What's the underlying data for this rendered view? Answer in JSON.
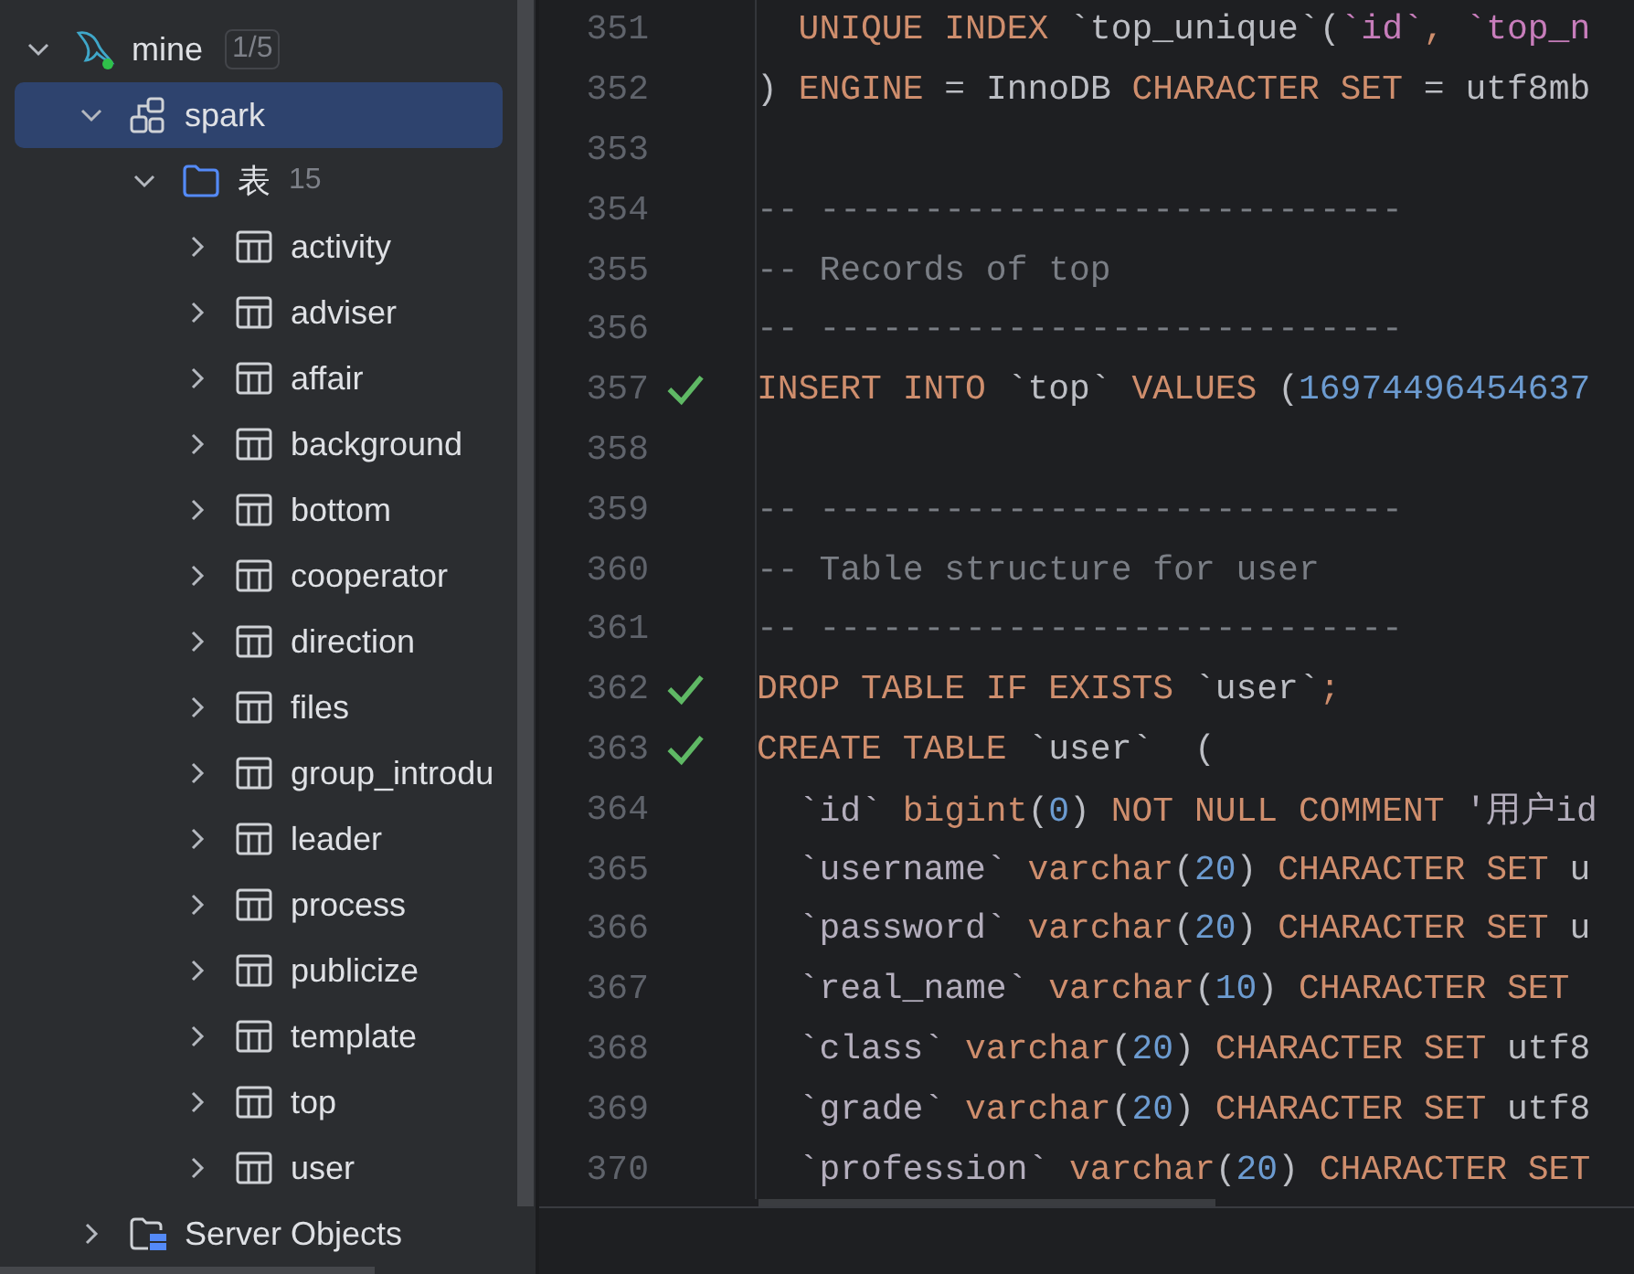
{
  "tree": [
    {
      "kind": "connection",
      "label": "mine",
      "badge": "1/5",
      "expanded": true,
      "selected": false,
      "children": [
        {
          "kind": "schema",
          "label": "spark",
          "expanded": true,
          "selected": true,
          "children": [
            {
              "kind": "folder",
              "label": "表",
              "count": "15",
              "expanded": true,
              "selected": false,
              "children": [
                {
                  "kind": "table",
                  "label": "activity",
                  "expanded": false,
                  "selected": false
                },
                {
                  "kind": "table",
                  "label": "adviser",
                  "expanded": false,
                  "selected": false
                },
                {
                  "kind": "table",
                  "label": "affair",
                  "expanded": false,
                  "selected": false
                },
                {
                  "kind": "table",
                  "label": "background",
                  "expanded": false,
                  "selected": false
                },
                {
                  "kind": "table",
                  "label": "bottom",
                  "expanded": false,
                  "selected": false
                },
                {
                  "kind": "table",
                  "label": "cooperator",
                  "expanded": false,
                  "selected": false
                },
                {
                  "kind": "table",
                  "label": "direction",
                  "expanded": false,
                  "selected": false
                },
                {
                  "kind": "table",
                  "label": "files",
                  "expanded": false,
                  "selected": false
                },
                {
                  "kind": "table",
                  "label": "group_introdu",
                  "expanded": false,
                  "selected": false
                },
                {
                  "kind": "table",
                  "label": "leader",
                  "expanded": false,
                  "selected": false
                },
                {
                  "kind": "table",
                  "label": "process",
                  "expanded": false,
                  "selected": false
                },
                {
                  "kind": "table",
                  "label": "publicize",
                  "expanded": false,
                  "selected": false
                },
                {
                  "kind": "table",
                  "label": "template",
                  "expanded": false,
                  "selected": false
                },
                {
                  "kind": "table",
                  "label": "top",
                  "expanded": false,
                  "selected": false
                },
                {
                  "kind": "table",
                  "label": "user",
                  "expanded": false,
                  "selected": false
                }
              ]
            }
          ]
        },
        {
          "kind": "server",
          "label": "Server Objects",
          "expanded": false,
          "selected": false
        }
      ]
    }
  ],
  "editor": {
    "lines": [
      {
        "number": "351",
        "checked": false,
        "indented": true,
        "tokens": [
          {
            "kind": "keyword",
            "text": "UNIQUE INDEX "
          },
          {
            "kind": "plain",
            "text": "`top_unique`("
          },
          {
            "kind": "field",
            "text": "`id`"
          },
          {
            "kind": "keyword",
            "text": ", "
          },
          {
            "kind": "field",
            "text": "`top_n"
          }
        ]
      },
      {
        "number": "352",
        "checked": false,
        "indented": false,
        "tokens": [
          {
            "kind": "plain",
            "text": ") "
          },
          {
            "kind": "keyword",
            "text": "ENGINE"
          },
          {
            "kind": "plain",
            "text": " = InnoDB "
          },
          {
            "kind": "keyword",
            "text": "CHARACTER SET"
          },
          {
            "kind": "plain",
            "text": " = utf8mb"
          }
        ]
      },
      {
        "number": "353",
        "checked": false
      },
      {
        "number": "354",
        "checked": false,
        "indented": false,
        "tokens": [
          {
            "kind": "comment",
            "text": "-- ----------------------------"
          }
        ]
      },
      {
        "number": "355",
        "checked": false,
        "indented": false,
        "tokens": [
          {
            "kind": "comment",
            "text": "-- Records of top"
          }
        ]
      },
      {
        "number": "356",
        "checked": false,
        "indented": false,
        "tokens": [
          {
            "kind": "comment",
            "text": "-- ----------------------------"
          }
        ]
      },
      {
        "number": "357",
        "checked": true,
        "indented": false,
        "tokens": [
          {
            "kind": "keyword",
            "text": "INSERT INTO"
          },
          {
            "kind": "plain",
            "text": " `top` "
          },
          {
            "kind": "keyword",
            "text": "VALUES"
          },
          {
            "kind": "plain",
            "text": " ("
          },
          {
            "kind": "number",
            "text": "16974496454637"
          }
        ]
      },
      {
        "number": "358",
        "checked": false
      },
      {
        "number": "359",
        "checked": false,
        "indented": false,
        "tokens": [
          {
            "kind": "comment",
            "text": "-- ----------------------------"
          }
        ]
      },
      {
        "number": "360",
        "checked": false,
        "indented": false,
        "tokens": [
          {
            "kind": "comment",
            "text": "-- Table structure for user"
          }
        ]
      },
      {
        "number": "361",
        "checked": false,
        "indented": false,
        "tokens": [
          {
            "kind": "comment",
            "text": "-- ----------------------------"
          }
        ]
      },
      {
        "number": "362",
        "checked": true,
        "indented": false,
        "tokens": [
          {
            "kind": "keyword",
            "text": "DROP TABLE IF EXISTS"
          },
          {
            "kind": "plain",
            "text": " `user`"
          },
          {
            "kind": "keyword",
            "text": ";"
          }
        ]
      },
      {
        "number": "363",
        "checked": true,
        "indented": false,
        "tokens": [
          {
            "kind": "keyword",
            "text": "CREATE TABLE"
          },
          {
            "kind": "plain",
            "text": " `user`  ("
          }
        ]
      },
      {
        "number": "364",
        "checked": false,
        "indented": true,
        "tokens": [
          {
            "kind": "name",
            "text": "`id` "
          },
          {
            "kind": "keyword",
            "text": "bigint"
          },
          {
            "kind": "plain",
            "text": "("
          },
          {
            "kind": "number",
            "text": "0"
          },
          {
            "kind": "plain",
            "text": ") "
          },
          {
            "kind": "keyword",
            "text": "NOT NULL COMMENT"
          },
          {
            "kind": "name",
            "text": " '用户id"
          }
        ]
      },
      {
        "number": "365",
        "checked": false,
        "indented": true,
        "tokens": [
          {
            "kind": "name",
            "text": "`username` "
          },
          {
            "kind": "keyword",
            "text": "varchar"
          },
          {
            "kind": "plain",
            "text": "("
          },
          {
            "kind": "number",
            "text": "20"
          },
          {
            "kind": "plain",
            "text": ") "
          },
          {
            "kind": "keyword",
            "text": "CHARACTER SET"
          },
          {
            "kind": "plain",
            "text": " u"
          }
        ]
      },
      {
        "number": "366",
        "checked": false,
        "indented": true,
        "tokens": [
          {
            "kind": "name",
            "text": "`password` "
          },
          {
            "kind": "keyword",
            "text": "varchar"
          },
          {
            "kind": "plain",
            "text": "("
          },
          {
            "kind": "number",
            "text": "20"
          },
          {
            "kind": "plain",
            "text": ") "
          },
          {
            "kind": "keyword",
            "text": "CHARACTER SET"
          },
          {
            "kind": "plain",
            "text": " u"
          }
        ]
      },
      {
        "number": "367",
        "checked": false,
        "indented": true,
        "tokens": [
          {
            "kind": "name",
            "text": "`real_name` "
          },
          {
            "kind": "keyword",
            "text": "varchar"
          },
          {
            "kind": "plain",
            "text": "("
          },
          {
            "kind": "number",
            "text": "10"
          },
          {
            "kind": "plain",
            "text": ") "
          },
          {
            "kind": "keyword",
            "text": "CHARACTER SET"
          }
        ]
      },
      {
        "number": "368",
        "checked": false,
        "indented": true,
        "tokens": [
          {
            "kind": "name",
            "text": "`class` "
          },
          {
            "kind": "keyword",
            "text": "varchar"
          },
          {
            "kind": "plain",
            "text": "("
          },
          {
            "kind": "number",
            "text": "20"
          },
          {
            "kind": "plain",
            "text": ") "
          },
          {
            "kind": "keyword",
            "text": "CHARACTER SET"
          },
          {
            "kind": "plain",
            "text": " utf8"
          }
        ]
      },
      {
        "number": "369",
        "checked": false,
        "indented": true,
        "tokens": [
          {
            "kind": "name",
            "text": "`grade` "
          },
          {
            "kind": "keyword",
            "text": "varchar"
          },
          {
            "kind": "plain",
            "text": "("
          },
          {
            "kind": "number",
            "text": "20"
          },
          {
            "kind": "plain",
            "text": ") "
          },
          {
            "kind": "keyword",
            "text": "CHARACTER SET"
          },
          {
            "kind": "plain",
            "text": " utf8"
          }
        ]
      },
      {
        "number": "370",
        "checked": false,
        "indented": true,
        "tokens": [
          {
            "kind": "name",
            "text": "`profession` "
          },
          {
            "kind": "keyword",
            "text": "varchar"
          },
          {
            "kind": "plain",
            "text": "("
          },
          {
            "kind": "number",
            "text": "20"
          },
          {
            "kind": "plain",
            "text": ") "
          },
          {
            "kind": "keyword",
            "text": "CHARACTER SET"
          }
        ]
      }
    ]
  }
}
